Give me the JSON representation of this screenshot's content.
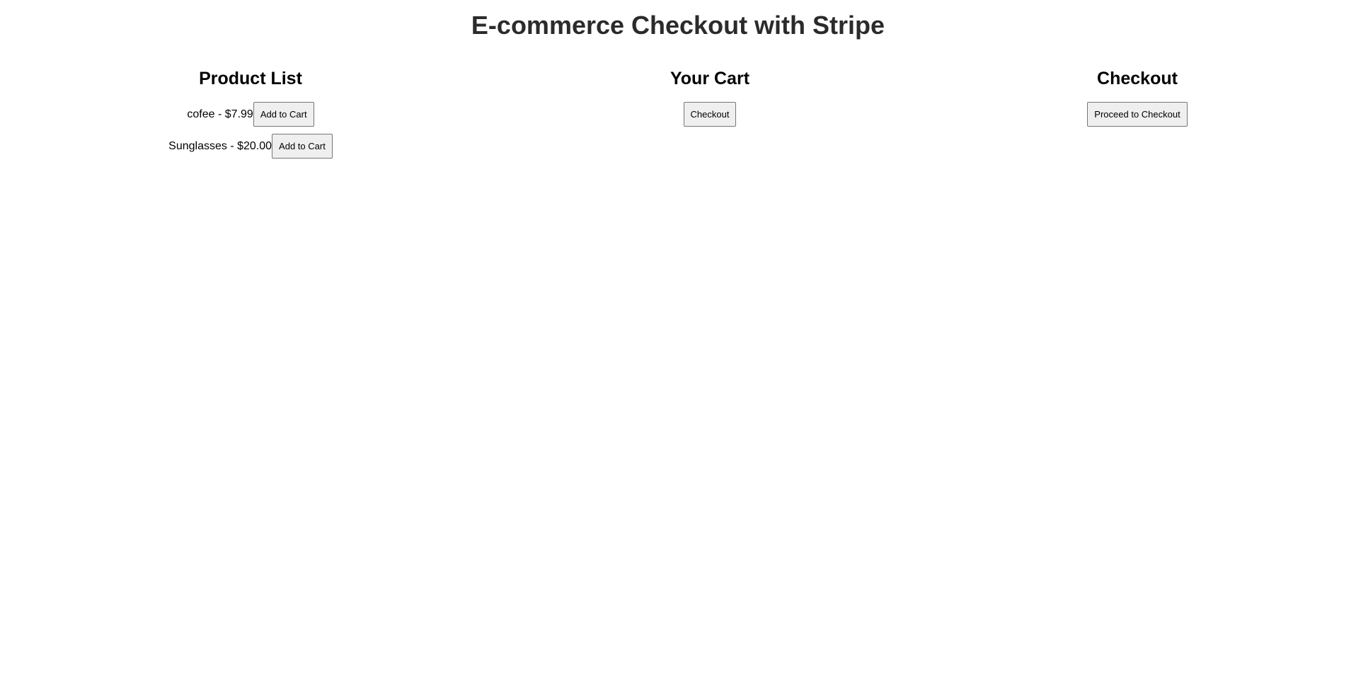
{
  "page": {
    "title": "E-commerce Checkout with Stripe"
  },
  "product_list": {
    "heading": "Product List",
    "items": [
      {
        "text": "cofee - $7.99",
        "button_label": "Add to Cart"
      },
      {
        "text": "Sunglasses - $20.00",
        "button_label": "Add to Cart"
      }
    ]
  },
  "cart": {
    "heading": "Your Cart",
    "checkout_label": "Checkout"
  },
  "checkout": {
    "heading": "Checkout",
    "proceed_label": "Proceed to Checkout"
  },
  "colors": {
    "title": "#2b2b2b",
    "button_bg": "#efefef",
    "button_border": "#767676"
  }
}
